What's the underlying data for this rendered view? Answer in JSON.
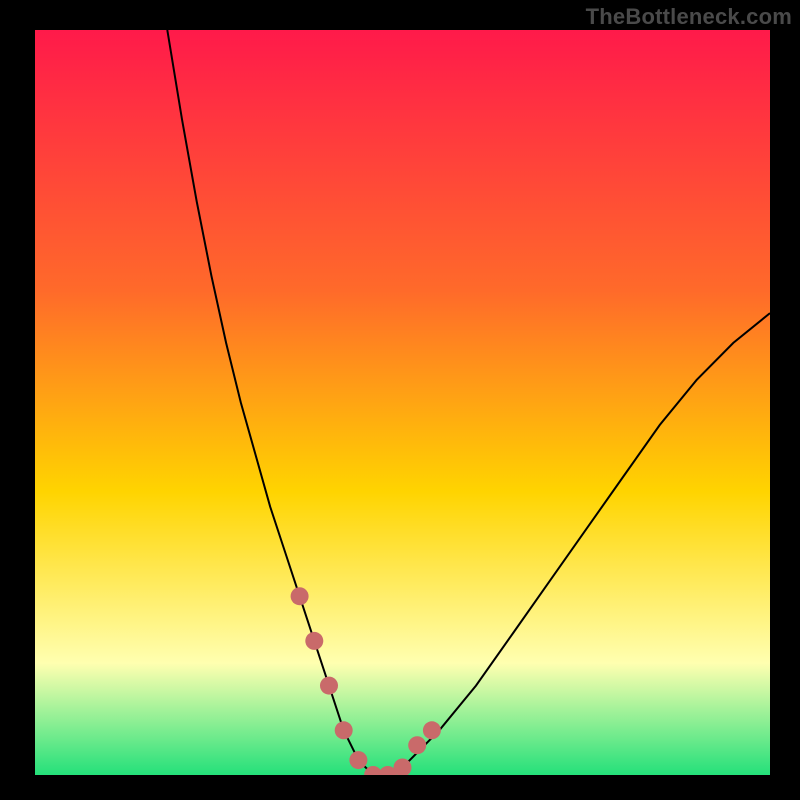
{
  "watermark": "TheBottleneck.com",
  "colors": {
    "background": "#000000",
    "gradient_top": "#ff1a4a",
    "gradient_mid1": "#ff6a2a",
    "gradient_mid2": "#ffd400",
    "gradient_pale": "#ffffb0",
    "gradient_bottom": "#24e07a",
    "curve": "#000000",
    "marker": "#c96a6a"
  },
  "chart_data": {
    "type": "line",
    "title": "",
    "xlabel": "",
    "ylabel": "",
    "xlim": [
      0,
      100
    ],
    "ylim": [
      0,
      100
    ],
    "series": [
      {
        "name": "bottleneck-curve",
        "x": [
          18,
          20,
          22,
          24,
          26,
          28,
          30,
          32,
          34,
          36,
          38,
          40,
          42,
          44,
          46,
          48,
          50,
          55,
          60,
          65,
          70,
          75,
          80,
          85,
          90,
          95,
          100
        ],
        "values": [
          100,
          88,
          77,
          67,
          58,
          50,
          43,
          36,
          30,
          24,
          18,
          12,
          6,
          2,
          0,
          0,
          1,
          6,
          12,
          19,
          26,
          33,
          40,
          47,
          53,
          58,
          62
        ]
      }
    ],
    "markers": {
      "name": "highlight-points",
      "x": [
        36,
        38,
        40,
        42,
        44,
        46,
        48,
        50,
        52,
        54
      ],
      "values": [
        24,
        18,
        12,
        6,
        2,
        0,
        0,
        1,
        4,
        6
      ]
    },
    "legend": false,
    "grid": false
  }
}
